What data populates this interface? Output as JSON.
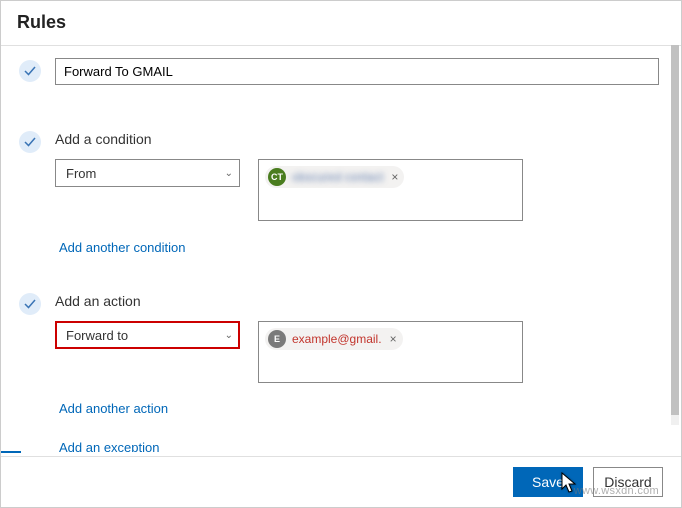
{
  "dialog": {
    "title": "Rules"
  },
  "rule_name": {
    "value": "Forward To GMAIL"
  },
  "condition": {
    "title": "Add a condition",
    "selector_value": "From",
    "chip": {
      "initials": "CT",
      "label": "obscured contact"
    },
    "add_link": "Add another condition"
  },
  "action": {
    "title": "Add an action",
    "selector_value": "Forward to",
    "chip": {
      "initials": "E",
      "label": "example@gmail."
    },
    "add_action_link": "Add another action",
    "add_exception_link": "Add an exception"
  },
  "footer": {
    "save": "Save",
    "discard": "Discard"
  },
  "watermark": "www.wsxdn.com"
}
